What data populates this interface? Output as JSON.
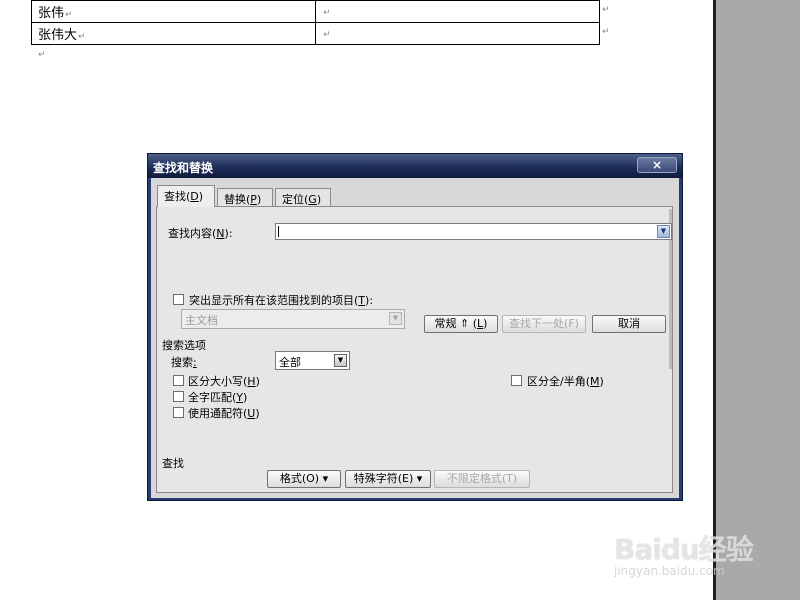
{
  "document": {
    "rows": [
      {
        "name": "张伟",
        "value": ""
      },
      {
        "name": "张伟大",
        "value": ""
      }
    ],
    "pilcrow": "↵"
  },
  "dialog": {
    "title": "查找和替换",
    "close_label": "×",
    "tabs": [
      {
        "label": "查找",
        "key": "D",
        "active": true
      },
      {
        "label": "替换",
        "key": "P",
        "active": false
      },
      {
        "label": "定位",
        "key": "G",
        "active": false
      }
    ],
    "find_label": "查找内容",
    "find_key": "N",
    "find_value": "",
    "highlight_label": "突出显示所有在该范围找到的项目",
    "highlight_key": "T",
    "scope_value": "主文档",
    "buttons": {
      "normal": "常规",
      "normal_arrow": "⇑",
      "normal_key": "L",
      "find_next": "查找下一处(F)",
      "cancel": "取消"
    },
    "search_options_title": "搜索选项",
    "search_label": "搜索",
    "search_value": "全部",
    "options": [
      {
        "label": "区分大小写",
        "key": "H"
      },
      {
        "label": "全字匹配",
        "key": "Y"
      },
      {
        "label": "使用通配符",
        "key": "U"
      }
    ],
    "fullwidth_option": {
      "label": "区分全/半角",
      "key": "M"
    },
    "find_section_title": "查找",
    "bottom_buttons": {
      "format": "格式(O)",
      "special": "特殊字符(E)",
      "no_format": "不限定格式(T)"
    }
  },
  "watermark": {
    "main": "Baidu经验",
    "sub": "jingyan.baidu.com"
  }
}
